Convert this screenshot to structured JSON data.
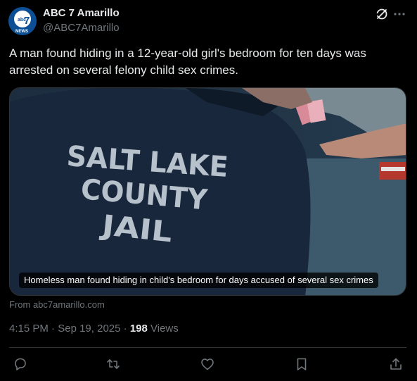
{
  "author": {
    "display_name": "ABC 7 Amarillo",
    "handle": "@ABC7Amarillo",
    "avatar_text": "abc 7 NEWS"
  },
  "post": {
    "text": "A man found hiding in a 12-year-old girl's bedroom for ten days was arrested on several felony child sex crimes."
  },
  "media": {
    "image_text": "SALT LAKE COUNTY JAIL",
    "caption": "Homeless man found hiding in child's bedroom for days accused of several sex crimes",
    "source": "From abc7amarillo.com"
  },
  "meta": {
    "time": "4:15 PM",
    "separator": "·",
    "date": "Sep 19, 2025",
    "views_count": "198",
    "views_label": "Views"
  },
  "icons": {
    "header": [
      "grok-icon",
      "more-icon"
    ],
    "actions": [
      "reply-icon",
      "repost-icon",
      "like-icon",
      "bookmark-icon",
      "share-icon"
    ]
  },
  "colors": {
    "background": "#000000",
    "text_primary": "#e7e9ea",
    "text_secondary": "#71767b",
    "border": "#2f3336",
    "avatar_blue": "#0d4f95"
  }
}
